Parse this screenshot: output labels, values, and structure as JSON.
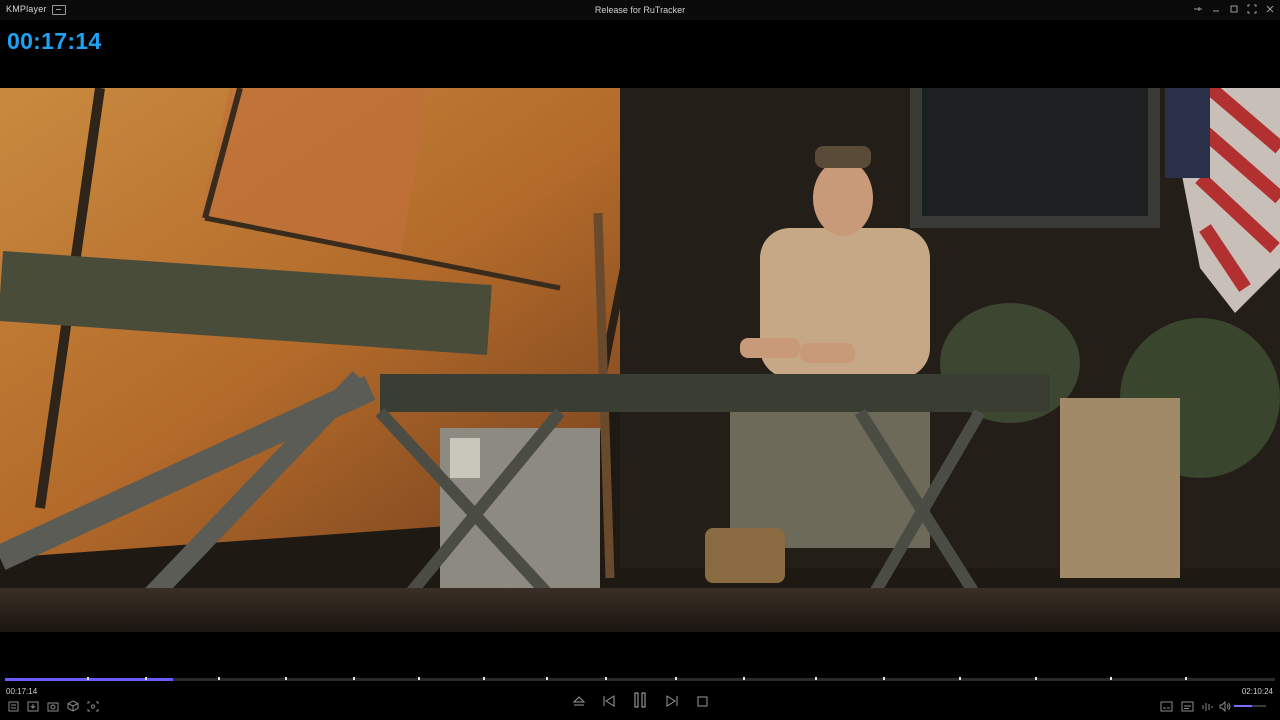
{
  "app": {
    "name": "KMPlayer",
    "window_title": "Release for RuTracker"
  },
  "osd": {
    "current_time": "00:17:14"
  },
  "playback": {
    "current_time": "00:17:14",
    "total_time": "02:10:24",
    "progress_fraction": 0.132,
    "volume_fraction": 0.55,
    "state": "playing"
  },
  "colors": {
    "osd_text": "#1ea2f5",
    "seek_fill": "#6b5cff",
    "background": "#000000"
  },
  "icons": {
    "title_bar": [
      "menu-icon",
      "pin-icon",
      "minimize-icon",
      "maximize-icon",
      "fullscreen-icon",
      "close-icon"
    ],
    "left_controls": [
      "playlist-icon",
      "open-icon",
      "capture-icon",
      "3d-icon",
      "vr-icon"
    ],
    "center_controls": [
      "eject-icon",
      "previous-icon",
      "pause-icon",
      "next-icon",
      "stop-icon"
    ],
    "right_controls": [
      "video-mode-icon",
      "subtitle-icon",
      "equalizer-icon",
      "volume-icon"
    ]
  }
}
